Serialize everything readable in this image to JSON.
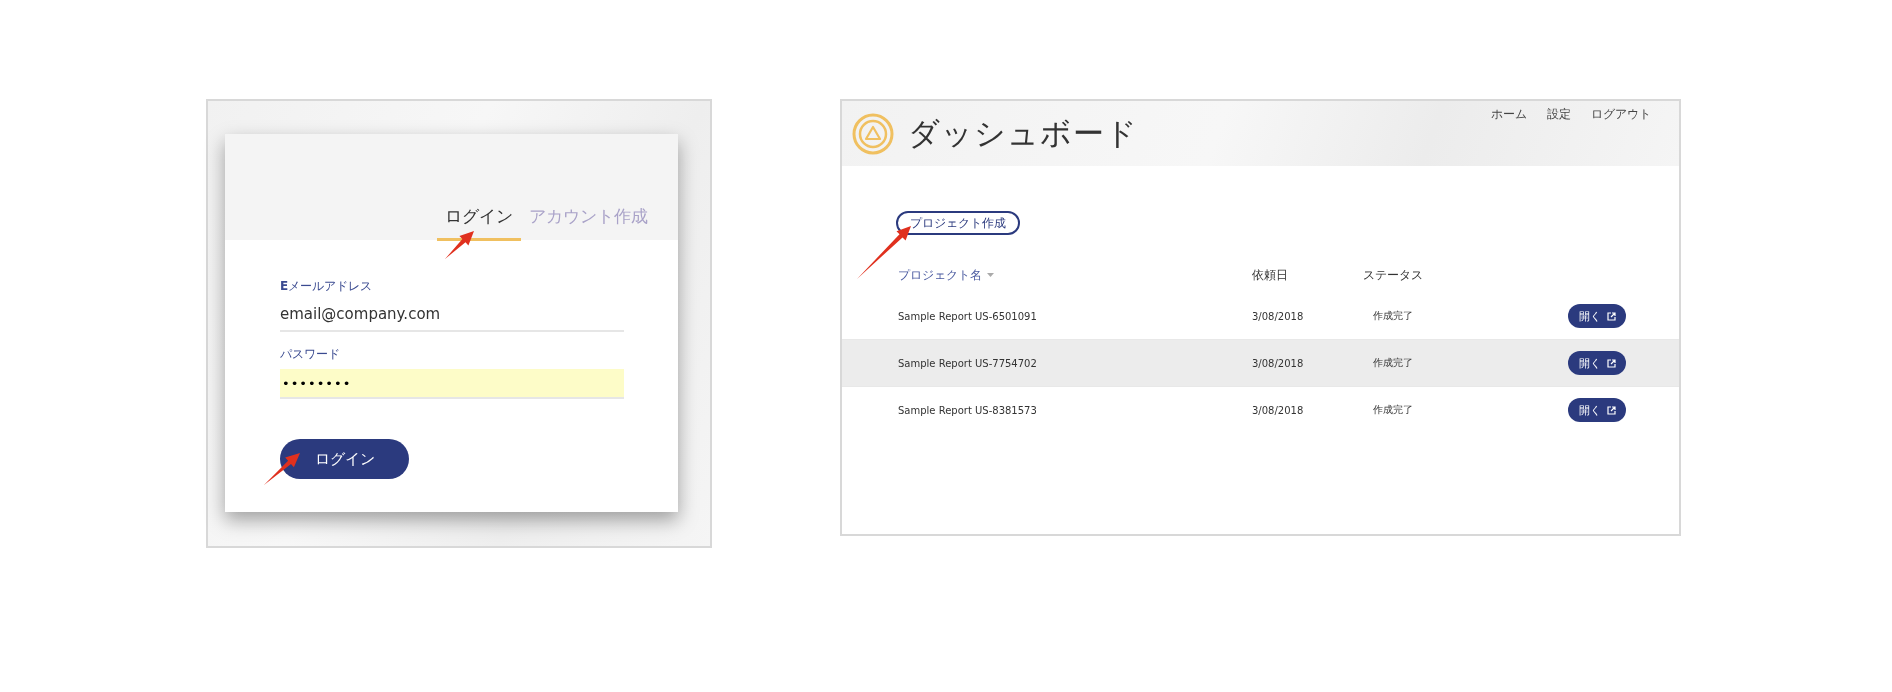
{
  "login_screen": {
    "tabs": [
      {
        "label": "ログイン",
        "selected": true
      },
      {
        "label": "アカウント作成",
        "selected": false
      }
    ],
    "email_field": {
      "label": "**E**メールアドレス",
      "value": "email@company.com"
    },
    "password_field": {
      "label": "パスワード",
      "value": "••••••••",
      "autofilled": true
    },
    "login_button": "ログイン"
  },
  "dashboard": {
    "title": "ダッシュボード",
    "nav": [
      "ホーム",
      "設定",
      "ログアウト"
    ],
    "create_button": "プロジェクト作成",
    "table": {
      "columns": [
        {
          "label": "プロジェクト名",
          "sortable": true
        },
        {
          "label": "依頼日",
          "sortable": false
        },
        {
          "label": "ステータス",
          "sortable": false
        }
      ],
      "rows": [
        {
          "name": "Sample Report US-6501091",
          "date": "3/08/2018",
          "status": "作成完了",
          "action": "開く",
          "highlighted": false
        },
        {
          "name": "Sample Report US-7754702",
          "date": "3/08/2018",
          "status": "作成完了",
          "action": "開く",
          "highlighted": true
        },
        {
          "name": "Sample Report US-8381573",
          "date": "3/08/2018",
          "status": "作成完了",
          "action": "開く",
          "highlighted": false
        }
      ]
    }
  }
}
